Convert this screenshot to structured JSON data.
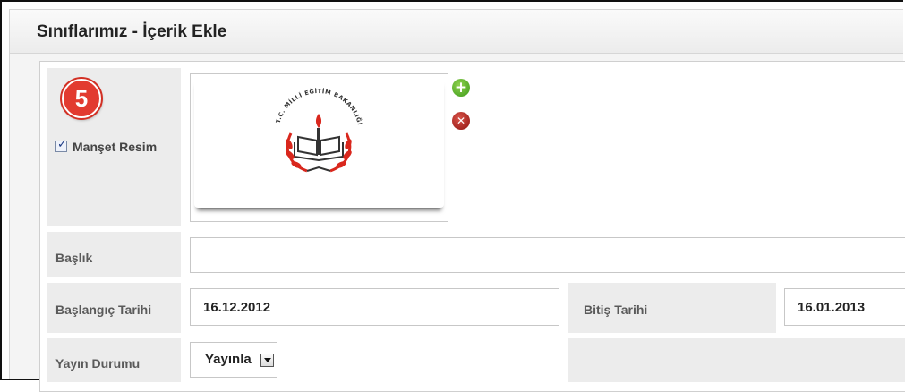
{
  "header": {
    "title": "Sınıflarımız - İçerik Ekle"
  },
  "step_badge": "5",
  "image_row": {
    "checkbox_label": "Manşet Resim",
    "checkbox_checked": true,
    "logo_text": "T.C. MİLLİ EĞİTİM BAKANLIĞI",
    "add_icon": "plus-circle-icon",
    "delete_icon": "x-circle-icon"
  },
  "fields": {
    "title_label": "Başlık",
    "title_value": "",
    "start_label": "Başlangıç Tarihi",
    "start_value": "16.12.2012",
    "end_label": "Bitiş Tarihi",
    "end_value": "16.01.2013",
    "status_label": "Yayın Durumu",
    "status_value": "Yayınla"
  },
  "colors": {
    "badge": "#e23b30",
    "add_icon": "#3c9a1a",
    "delete_icon": "#8f1410",
    "label_cell": "#ececec"
  }
}
